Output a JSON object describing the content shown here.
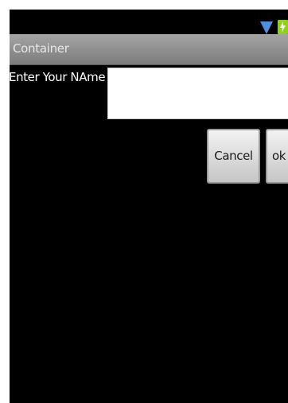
{
  "app": {
    "title": "Container"
  },
  "status_bar": {
    "icons": [
      "wifi-icon",
      "battery-charging-icon"
    ],
    "wifi_color": "#4f8fe0",
    "battery_color": "#8fd11a"
  },
  "form": {
    "name_label": "Enter Your NAme",
    "name_value": "",
    "name_placeholder": ""
  },
  "buttons": {
    "cancel_label": "Cancel",
    "ok_label": "ok"
  }
}
